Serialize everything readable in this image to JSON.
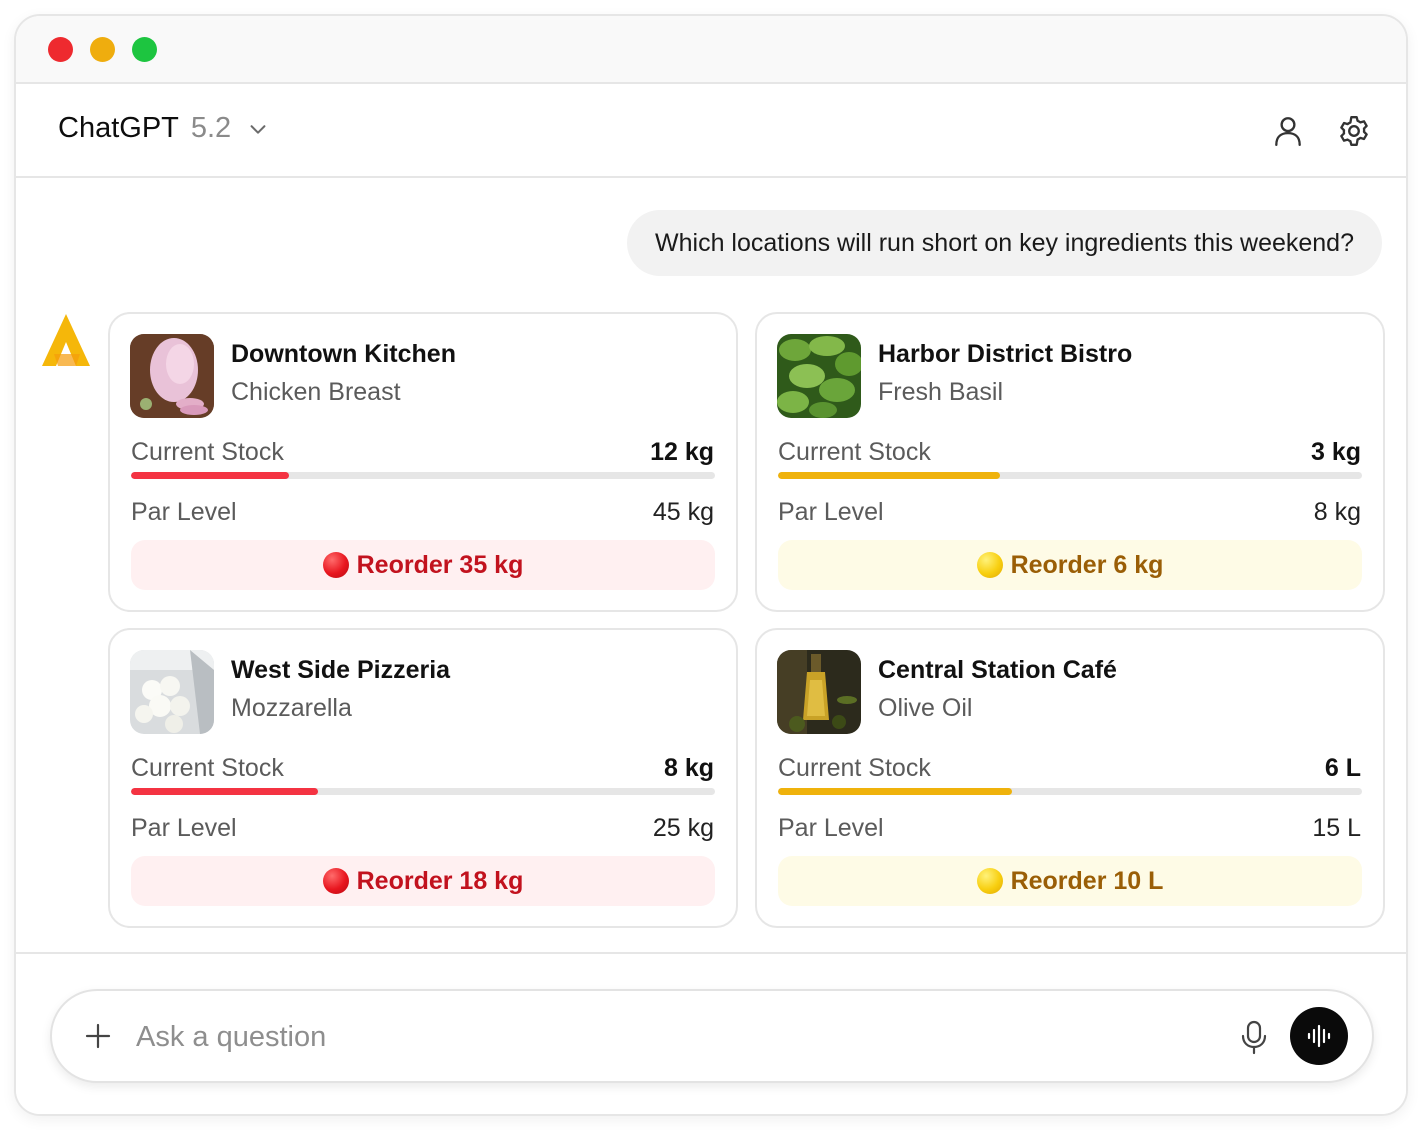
{
  "window": {
    "traffic_lights": [
      "close",
      "minimize",
      "zoom"
    ],
    "colors": {
      "close": "#ee2a2f",
      "minimize": "#efad0e",
      "zoom": "#1dc540"
    }
  },
  "header": {
    "app_name": "ChatGPT",
    "version": "5.2",
    "icons": [
      "chevron-down-icon",
      "user-icon",
      "gear-icon"
    ]
  },
  "chat": {
    "user_message": "Which locations will run short on key ingredients this weekend?",
    "assistant_avatar": "logo-a-icon",
    "cards": [
      {
        "location": "Downtown Kitchen",
        "ingredient": "Chicken Breast",
        "thumbnail": "chicken-breast-photo",
        "stock_label": "Current Stock",
        "stock_value": "12 kg",
        "stock_fraction": 0.27,
        "par_label": "Par Level",
        "par_value": "45 kg",
        "status": "red",
        "reorder_text": "Reorder 35 kg"
      },
      {
        "location": "Harbor District Bistro",
        "ingredient": "Fresh Basil",
        "thumbnail": "fresh-basil-photo",
        "stock_label": "Current Stock",
        "stock_value": "3 kg",
        "stock_fraction": 0.38,
        "par_label": "Par Level",
        "par_value": "8 kg",
        "status": "yellow",
        "reorder_text": "Reorder 6 kg"
      },
      {
        "location": "West Side Pizzeria",
        "ingredient": "Mozzarella",
        "thumbnail": "mozzarella-photo",
        "stock_label": "Current Stock",
        "stock_value": "8 kg",
        "stock_fraction": 0.32,
        "par_label": "Par Level",
        "par_value": "25 kg",
        "status": "red",
        "reorder_text": "Reorder 18 kg"
      },
      {
        "location": "Central Station Café",
        "ingredient": "Olive Oil",
        "thumbnail": "olive-oil-photo",
        "stock_label": "Current Stock",
        "stock_value": "6 L",
        "stock_fraction": 0.4,
        "par_label": "Par Level",
        "par_value": "15 L",
        "status": "yellow",
        "reorder_text": "Reorder 10 L"
      }
    ]
  },
  "composer": {
    "placeholder": "Ask a question",
    "value": "",
    "icons": [
      "plus-icon",
      "microphone-icon",
      "voice-mode-icon"
    ]
  },
  "colors": {
    "red_bar": "#f43342",
    "yellow_bar": "#efb20c",
    "red_text": "#c2121e",
    "yellow_text": "#9a5e06",
    "red_bg": "#fff0f1",
    "yellow_bg": "#fefbe6",
    "logo": "#f5b70a"
  }
}
